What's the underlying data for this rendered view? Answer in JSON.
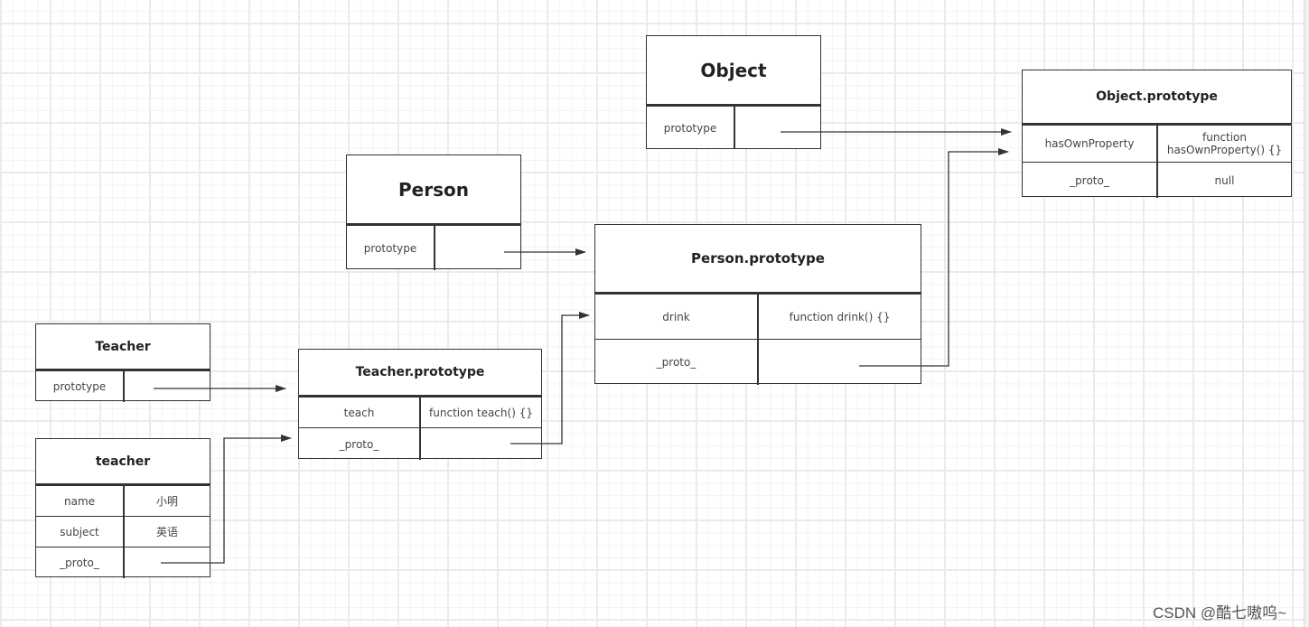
{
  "boxes": [
    {
      "id": "object",
      "title": "Object",
      "rows": [
        [
          "prototype",
          ""
        ]
      ]
    },
    {
      "id": "object-prototype",
      "title": "Object.prototype",
      "rows": [
        [
          "hasOwnProperty",
          "function\nhasOwnProperty() {}"
        ],
        [
          "_proto_",
          "null"
        ]
      ]
    },
    {
      "id": "person",
      "title": "Person",
      "rows": [
        [
          "prototype",
          ""
        ]
      ]
    },
    {
      "id": "person-prototype",
      "title": "Person.prototype",
      "rows": [
        [
          "drink",
          "function drink() {}"
        ],
        [
          "_proto_",
          ""
        ]
      ]
    },
    {
      "id": "teacher-class",
      "title": "Teacher",
      "rows": [
        [
          "prototype",
          ""
        ]
      ]
    },
    {
      "id": "teacher-prototype",
      "title": "Teacher.prototype",
      "rows": [
        [
          "teach",
          "function teach() {}"
        ],
        [
          "_proto_",
          ""
        ]
      ]
    },
    {
      "id": "teacher-instance",
      "title": "teacher",
      "rows": [
        [
          "name",
          "小明"
        ],
        [
          "subject",
          "英语"
        ],
        [
          "_proto_",
          ""
        ]
      ]
    }
  ],
  "links": [
    {
      "from": "Object.prototype",
      "to": "Object.prototype"
    },
    {
      "from": "Person.prototype._proto_",
      "to": "Object.prototype"
    },
    {
      "from": "Person.prototype",
      "to": "Person.prototype"
    },
    {
      "from": "Teacher.prototype",
      "to": "Teacher.prototype"
    },
    {
      "from": "Teacher.prototype._proto_",
      "to": "Person.prototype"
    },
    {
      "from": "teacher._proto_",
      "to": "Teacher.prototype"
    }
  ],
  "watermark": "CSDN @酷七嗷呜~"
}
